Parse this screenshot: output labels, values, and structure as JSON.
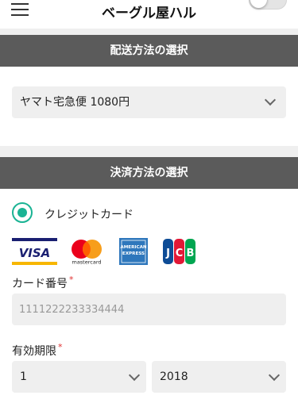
{
  "header": {
    "title": "ベーグル屋ハル",
    "icons": {
      "menu": "hamburger-menu-icon",
      "toggle": "toggle-switch"
    }
  },
  "shipping": {
    "section_title": "配送方法の選択",
    "selected_option": "ヤマト宅急便 1080円"
  },
  "payment": {
    "section_title": "決済方法の選択",
    "method_label": "クレジットカード",
    "method_selected": true,
    "accent_color": "#1ab394",
    "card_brands": [
      "VISA",
      "mastercard",
      "AMERICAN EXPRESS",
      "JCB"
    ],
    "card_number": {
      "label": "カード番号",
      "required_mark": "*",
      "placeholder": "1111222233334444"
    },
    "expiry": {
      "label": "有効期限",
      "required_mark": "*",
      "month": "1",
      "year": "2018"
    }
  }
}
